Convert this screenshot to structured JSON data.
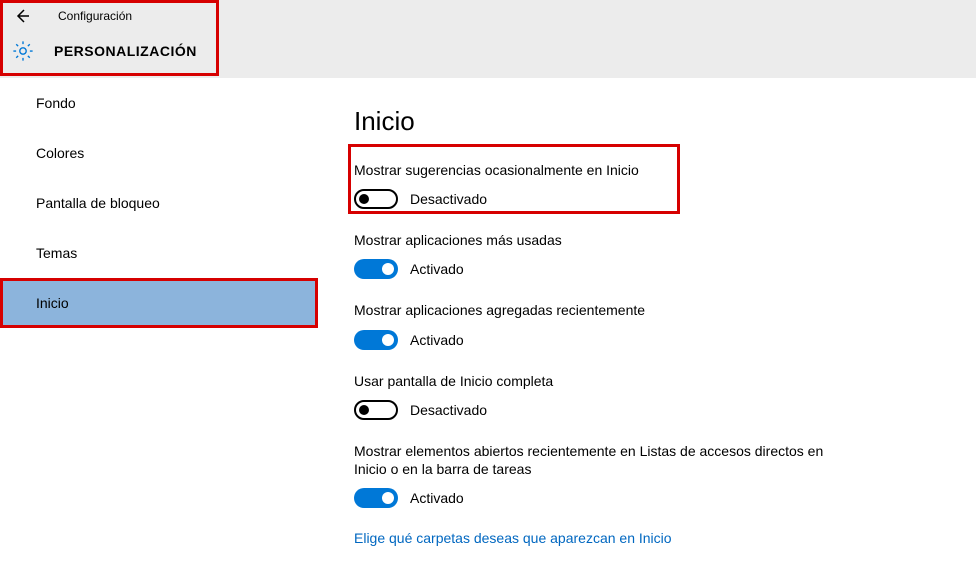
{
  "header": {
    "config_label": "Configuración",
    "section_title": "PERSONALIZACIÓN"
  },
  "sidebar": {
    "items": [
      {
        "label": "Fondo"
      },
      {
        "label": "Colores"
      },
      {
        "label": "Pantalla de bloqueo"
      },
      {
        "label": "Temas"
      },
      {
        "label": "Inicio"
      }
    ]
  },
  "content": {
    "page_title": "Inicio",
    "settings": [
      {
        "label": "Mostrar sugerencias ocasionalmente en Inicio",
        "on": false,
        "state_text": "Desactivado"
      },
      {
        "label": "Mostrar aplicaciones más usadas",
        "on": true,
        "state_text": "Activado"
      },
      {
        "label": "Mostrar aplicaciones agregadas recientemente",
        "on": true,
        "state_text": "Activado"
      },
      {
        "label": "Usar pantalla de Inicio completa",
        "on": false,
        "state_text": "Desactivado"
      },
      {
        "label": "Mostrar elementos abiertos recientemente en Listas de accesos directos en Inicio o en la barra de tareas",
        "on": true,
        "state_text": "Activado"
      }
    ],
    "link_text": "Elige qué carpetas deseas que aparezcan en Inicio"
  }
}
